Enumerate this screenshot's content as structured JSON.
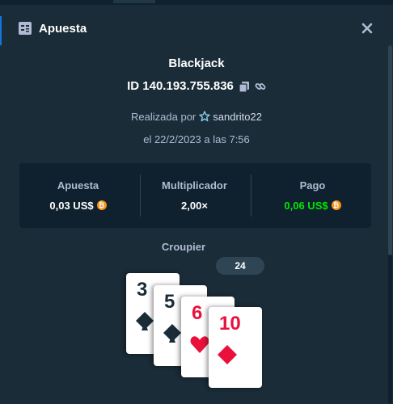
{
  "modal": {
    "title": "Apuesta",
    "icon": "bet-slip-icon",
    "close_icon": "close-icon"
  },
  "game": {
    "name": "Blackjack",
    "id": "ID 140.193.755.836",
    "copy_icon": "copy-icon",
    "link_icon": "link-icon"
  },
  "placed": {
    "prefix": "Realizada por",
    "user_icon": "vip-star-icon",
    "username": "sandrito22",
    "date": "el 22/2/2023 a las 7:56"
  },
  "stats": {
    "bet_label": "Apuesta",
    "bet_value": "0,03 US$",
    "multiplier_label": "Multiplicador",
    "multiplier_value": "2,00×",
    "payout_label": "Pago",
    "payout_value": "0,06 US$",
    "currency_icon": "bitcoin-icon"
  },
  "dealer": {
    "label": "Croupier",
    "score": "24",
    "cards": [
      {
        "rank": "3",
        "suit": "spades"
      },
      {
        "rank": "5",
        "suit": "spades"
      },
      {
        "rank": "6",
        "suit": "hearts"
      },
      {
        "rank": "10",
        "suit": "diamonds"
      }
    ]
  },
  "colors": {
    "background": "#1a2c38",
    "panel": "#0f212e",
    "muted_text": "#b1bad3",
    "payout_green": "#00e701",
    "card_red": "#e9113c",
    "card_black": "#1a2c38"
  }
}
